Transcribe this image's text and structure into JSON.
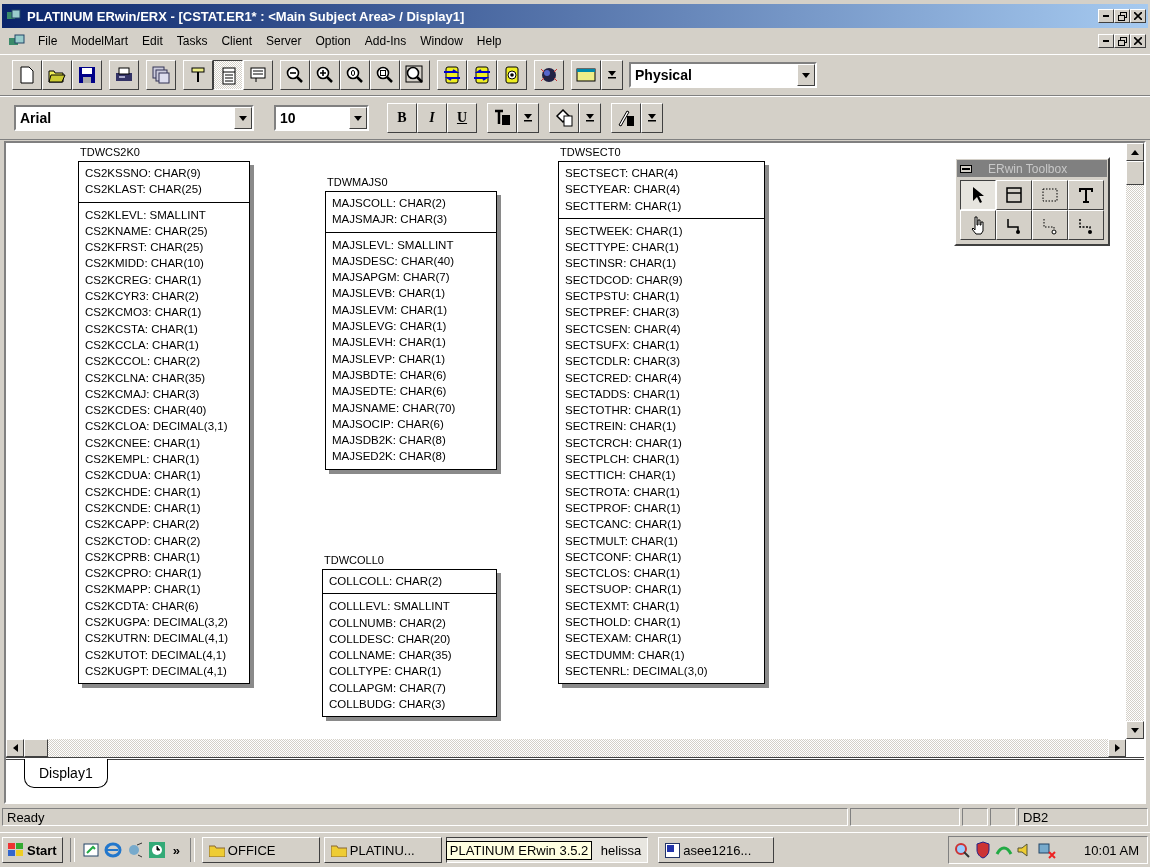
{
  "window": {
    "title": "PLATINUM ERwin/ERX - [CSTAT.ER1* : <Main Subject Area> / Display1]"
  },
  "menu": [
    "File",
    "ModelMart",
    "Edit",
    "Tasks",
    "Client",
    "Server",
    "Option",
    "Add-Ins",
    "Window",
    "Help"
  ],
  "toolbar": [
    {
      "kind": "new",
      "pressed": false
    },
    {
      "kind": "open",
      "pressed": false
    },
    {
      "kind": "save",
      "pressed": false
    },
    {
      "kind": "gap"
    },
    {
      "kind": "print",
      "pressed": false
    },
    {
      "kind": "gap"
    },
    {
      "kind": "stack",
      "pressed": false
    },
    {
      "kind": "gap"
    },
    {
      "kind": "stencil",
      "pressed": false
    },
    {
      "kind": "form",
      "pressed": true
    },
    {
      "kind": "note",
      "pressed": false
    },
    {
      "kind": "gap"
    },
    {
      "kind": "zoom-out",
      "pressed": false
    },
    {
      "kind": "zoom-in",
      "pressed": false
    },
    {
      "kind": "zoom-reset",
      "pressed": false
    },
    {
      "kind": "zoom-box",
      "pressed": false
    },
    {
      "kind": "zoom-page",
      "pressed": false
    },
    {
      "kind": "gap"
    },
    {
      "kind": "move-down",
      "pressed": false
    },
    {
      "kind": "move-up",
      "pressed": false
    },
    {
      "kind": "target",
      "pressed": false
    },
    {
      "kind": "gap"
    },
    {
      "kind": "globe",
      "pressed": false
    },
    {
      "kind": "gap"
    },
    {
      "kind": "window",
      "pressed": false
    },
    {
      "kind": "arrow",
      "pressed": false
    }
  ],
  "view_dropdown": {
    "value": "Physical"
  },
  "format_bar": {
    "font": "Arial",
    "size": "10",
    "styles": [
      "B",
      "I",
      "U"
    ]
  },
  "entities": [
    {
      "name": "TDWCS2K0",
      "keys": [
        "CS2KSSNO: CHAR(9)",
        "CS2KLAST: CHAR(25)"
      ],
      "attributes": [
        "CS2KLEVL: SMALLINT",
        "CS2KNAME: CHAR(25)",
        "CS2KFRST: CHAR(25)",
        "CS2KMIDD: CHAR(10)",
        "CS2KCREG: CHAR(1)",
        "CS2KCYR3: CHAR(2)",
        "CS2KCMO3: CHAR(1)",
        "CS2KCSTA: CHAR(1)",
        "CS2KCCLA: CHAR(1)",
        "CS2KCCOL: CHAR(2)",
        "CS2KCLNA: CHAR(35)",
        "CS2KCMAJ: CHAR(3)",
        "CS2KCDES: CHAR(40)",
        "CS2KCLOA: DECIMAL(3,1)",
        "CS2KCNEE: CHAR(1)",
        "CS2KEMPL: CHAR(1)",
        "CS2KCDUA: CHAR(1)",
        "CS2KCHDE: CHAR(1)",
        "CS2KCNDE: CHAR(1)",
        "CS2KCAPP: CHAR(2)",
        "CS2KCTOD: CHAR(2)",
        "CS2KCPRB: CHAR(1)",
        "CS2KCPRO: CHAR(1)",
        "CS2KMAPP: CHAR(1)",
        "CS2KCDTA: CHAR(6)",
        "CS2KUGPA: DECIMAL(3,2)",
        "CS2KUTRN: DECIMAL(4,1)",
        "CS2KUTOT: DECIMAL(4,1)",
        "CS2KUGPT: DECIMAL(4,1)"
      ]
    },
    {
      "name": "TDWMAJS0",
      "keys": [
        "MAJSCOLL: CHAR(2)",
        "MAJSMAJR: CHAR(3)"
      ],
      "attributes": [
        "MAJSLEVL: SMALLINT",
        "MAJSDESC: CHAR(40)",
        "MAJSAPGM: CHAR(7)",
        "MAJSLEVB: CHAR(1)",
        "MAJSLEVM: CHAR(1)",
        "MAJSLEVG: CHAR(1)",
        "MAJSLEVH: CHAR(1)",
        "MAJSLEVP: CHAR(1)",
        "MAJSBDTE: CHAR(6)",
        "MAJSEDTE: CHAR(6)",
        "MAJSNAME: CHAR(70)",
        "MAJSOCIP: CHAR(6)",
        "MAJSDB2K: CHAR(8)",
        "MAJSED2K: CHAR(8)"
      ]
    },
    {
      "name": "TDWCOLL0",
      "keys": [
        "COLLCOLL: CHAR(2)"
      ],
      "attributes": [
        "COLLLEVL: SMALLINT",
        "COLLNUMB: CHAR(2)",
        "COLLDESC: CHAR(20)",
        "COLLNAME: CHAR(35)",
        "COLLTYPE: CHAR(1)",
        "COLLAPGM: CHAR(7)",
        "COLLBUDG: CHAR(3)"
      ]
    },
    {
      "name": "TDWSECT0",
      "keys": [
        "SECTSECT: CHAR(4)",
        "SECTYEAR: CHAR(4)",
        "SECTTERM: CHAR(1)"
      ],
      "attributes": [
        "SECTWEEK: CHAR(1)",
        "SECTTYPE: CHAR(1)",
        "SECTINSR: CHAR(1)",
        "SECTDCOD: CHAR(9)",
        "SECTPSTU: CHAR(1)",
        "SECTPREF: CHAR(3)",
        "SECTCSEN: CHAR(4)",
        "SECTSUFX: CHAR(1)",
        "SECTCDLR: CHAR(3)",
        "SECTCRED: CHAR(4)",
        "SECTADDS: CHAR(1)",
        "SECTOTHR: CHAR(1)",
        "SECTREIN: CHAR(1)",
        "SECTCRCH: CHAR(1)",
        "SECTPLCH: CHAR(1)",
        "SECTTICH: CHAR(1)",
        "SECTROTA: CHAR(1)",
        "SECTPROF: CHAR(1)",
        "SECTCANC: CHAR(1)",
        "SECTMULT: CHAR(1)",
        "SECTCONF: CHAR(1)",
        "SECTCLOS: CHAR(1)",
        "SECTSUOP: CHAR(1)",
        "SECTEXMT: CHAR(1)",
        "SECTHOLD: CHAR(1)",
        "SECTEXAM: CHAR(1)",
        "SECTDUMM: CHAR(1)",
        "SECTENRL: DECIMAL(3,0)"
      ]
    }
  ],
  "toolbox": {
    "title": "ERwin Toolbox",
    "tools": [
      {
        "kind": "pointer",
        "selected": true
      },
      {
        "kind": "entity",
        "selected": false
      },
      {
        "kind": "subtype",
        "selected": false
      },
      {
        "kind": "text",
        "selected": false
      },
      {
        "kind": "hand",
        "selected": false
      },
      {
        "kind": "identifying",
        "selected": false
      },
      {
        "kind": "many",
        "selected": false
      },
      {
        "kind": "non-identifying",
        "selected": false
      }
    ]
  },
  "tabs": [
    {
      "label": "Display1",
      "selected": true
    }
  ],
  "status_bar": {
    "text": "Ready",
    "panel": "DB2"
  },
  "taskbar": {
    "start": "Start",
    "more": "»",
    "tasks": [
      {
        "label": "OFFICE",
        "kind": "folder",
        "pressed": false
      },
      {
        "label": "PLATINU...",
        "kind": "folder",
        "pressed": false
      },
      {
        "label": "helissa",
        "kind": "blank",
        "pressed": true
      },
      {
        "label": "asee1216...",
        "kind": "word",
        "pressed": false
      }
    ],
    "tooltip": "PLATINUM ERwin 3.5.2",
    "clock": "10:01 AM"
  }
}
